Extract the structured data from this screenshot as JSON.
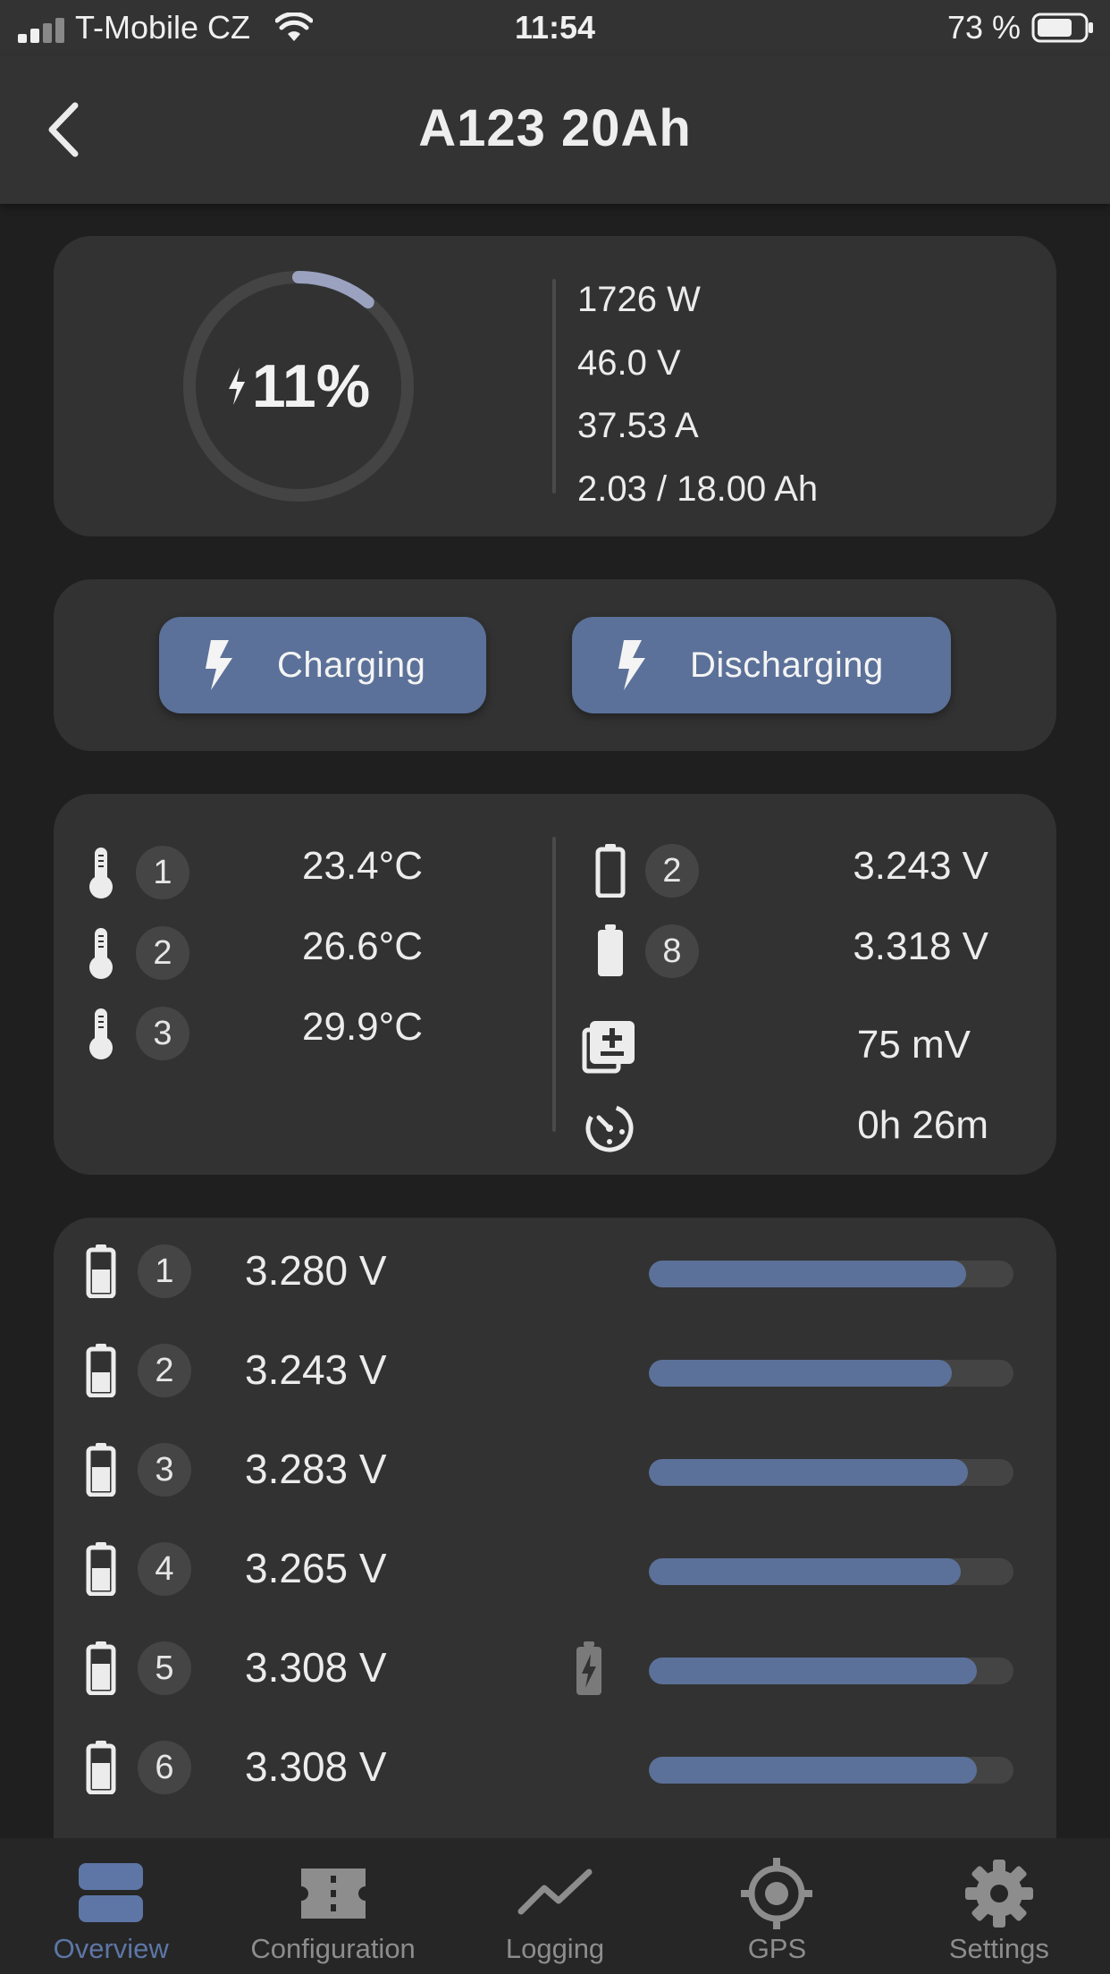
{
  "status_bar": {
    "carrier": "T-Mobile CZ",
    "time": "11:54",
    "battery_percent": "73 %"
  },
  "header": {
    "title": "A123 20Ah",
    "back_icon": "chevron-left-icon"
  },
  "summary": {
    "soc_percent": "11%",
    "soc_fraction": 0.11,
    "power": "1726 W",
    "voltage": "46.0 V",
    "current": "37.53 A",
    "capacity": "2.03 / 18.00 Ah"
  },
  "modes": {
    "charging_label": "Charging",
    "discharging_label": "Discharging"
  },
  "temperatures": [
    {
      "index": "1",
      "value": "23.4°C"
    },
    {
      "index": "2",
      "value": "26.6°C"
    },
    {
      "index": "3",
      "value": "29.9°C"
    }
  ],
  "cell_extremes": {
    "min": {
      "index": "2",
      "value": "3.243 V"
    },
    "max": {
      "index": "8",
      "value": "3.318 V"
    },
    "delta": "75 mV",
    "time": "0h 26m"
  },
  "cells": [
    {
      "index": "1",
      "voltage": "3.280 V",
      "fill": 0.87,
      "balancing": false
    },
    {
      "index": "2",
      "voltage": "3.243 V",
      "fill": 0.83,
      "balancing": false
    },
    {
      "index": "3",
      "voltage": "3.283 V",
      "fill": 0.875,
      "balancing": false
    },
    {
      "index": "4",
      "voltage": "3.265 V",
      "fill": 0.855,
      "balancing": false
    },
    {
      "index": "5",
      "voltage": "3.308 V",
      "fill": 0.9,
      "balancing": true
    },
    {
      "index": "6",
      "voltage": "3.308 V",
      "fill": 0.9,
      "balancing": false
    }
  ],
  "tabs": [
    {
      "label": "Overview",
      "icon": "overview-icon",
      "active": true
    },
    {
      "label": "Configuration",
      "icon": "configuration-icon",
      "active": false
    },
    {
      "label": "Logging",
      "icon": "logging-icon",
      "active": false
    },
    {
      "label": "GPS",
      "icon": "gps-icon",
      "active": false
    },
    {
      "label": "Settings",
      "icon": "settings-icon",
      "active": false
    }
  ],
  "colors": {
    "accent": "#5b7199",
    "card": "#323232",
    "background": "#1f1f1f",
    "header": "#333333",
    "ring_progress": "#9aa2c0",
    "ring_track": "#444444"
  }
}
